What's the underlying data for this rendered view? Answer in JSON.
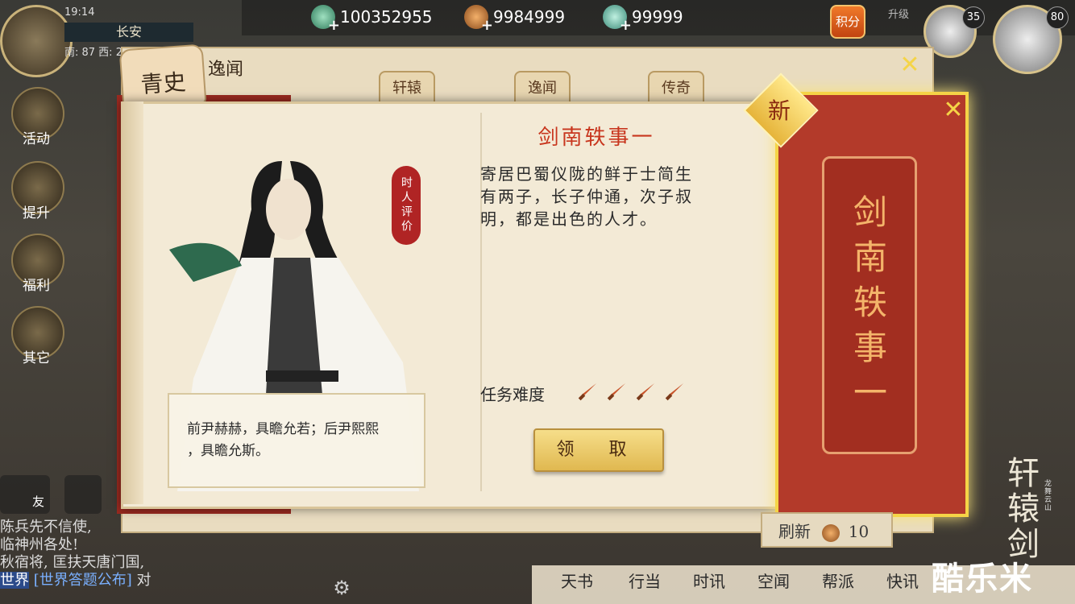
{
  "status": {
    "time": "19:14"
  },
  "location": {
    "city": "长安",
    "coords": "南: 87  西: 2"
  },
  "currencies": [
    {
      "value": "100352955",
      "icon": "jade-coin-icon"
    },
    {
      "value": "9984999",
      "icon": "copper-coin-icon"
    },
    {
      "value": "99999",
      "icon": "jade-token-icon"
    }
  ],
  "points_badge": "积分",
  "upgrade_label": "升级",
  "party": [
    {
      "level": "35"
    },
    {
      "level": "80"
    }
  ],
  "side_menu": [
    {
      "label": "活动"
    },
    {
      "label": "提升"
    },
    {
      "label": "福利"
    },
    {
      "label": "其它"
    }
  ],
  "back_panel": {
    "tab_main": "青史",
    "title": "逸闻",
    "tabs": [
      "轩辕",
      "逸闻",
      "传奇"
    ]
  },
  "quest": {
    "title": "剑南轶事一",
    "description": "寄居巴蜀仪陇的鲜于士简生有两子，长子仲通，次子叔明，都是出色的人才。",
    "desc_lines": [
      "寄居巴蜀仪陇的鲜于士简生",
      "有两子，长子仲通，次子叔",
      "明，都是出色的人才。"
    ],
    "seal": "时人评价",
    "quote_lines": [
      "前尹赫赫，具瞻允若；后尹熙熙",
      "，具瞻允斯。"
    ],
    "difficulty_label": "任务难度",
    "difficulty": 4,
    "claim_button": "领  取"
  },
  "card": {
    "title_chars": [
      "剑",
      "南",
      "轶",
      "事",
      "一"
    ],
    "new_badge": "新"
  },
  "refresh": {
    "label": "刷新",
    "cost": "10"
  },
  "bottom_nav": [
    "天书",
    "行当",
    "时讯",
    "空闻",
    "帮派",
    "快讯"
  ],
  "chat": {
    "lines": [
      "陈兵先不信使,",
      "临神州各处!",
      "秋宿将, 匡扶天唐门国,"
    ],
    "channel": "世界",
    "topic": "[世界答题公布]",
    "tail": "对"
  },
  "friend_label": "友",
  "logo": {
    "title_chars": [
      "轩",
      "辕",
      "剑"
    ],
    "subtitle": "龙舞云山"
  },
  "watermark": "酷乐米",
  "colors": {
    "accent_red": "#b33a2a",
    "gold": "#f5d447",
    "title_red": "#c8361e"
  }
}
